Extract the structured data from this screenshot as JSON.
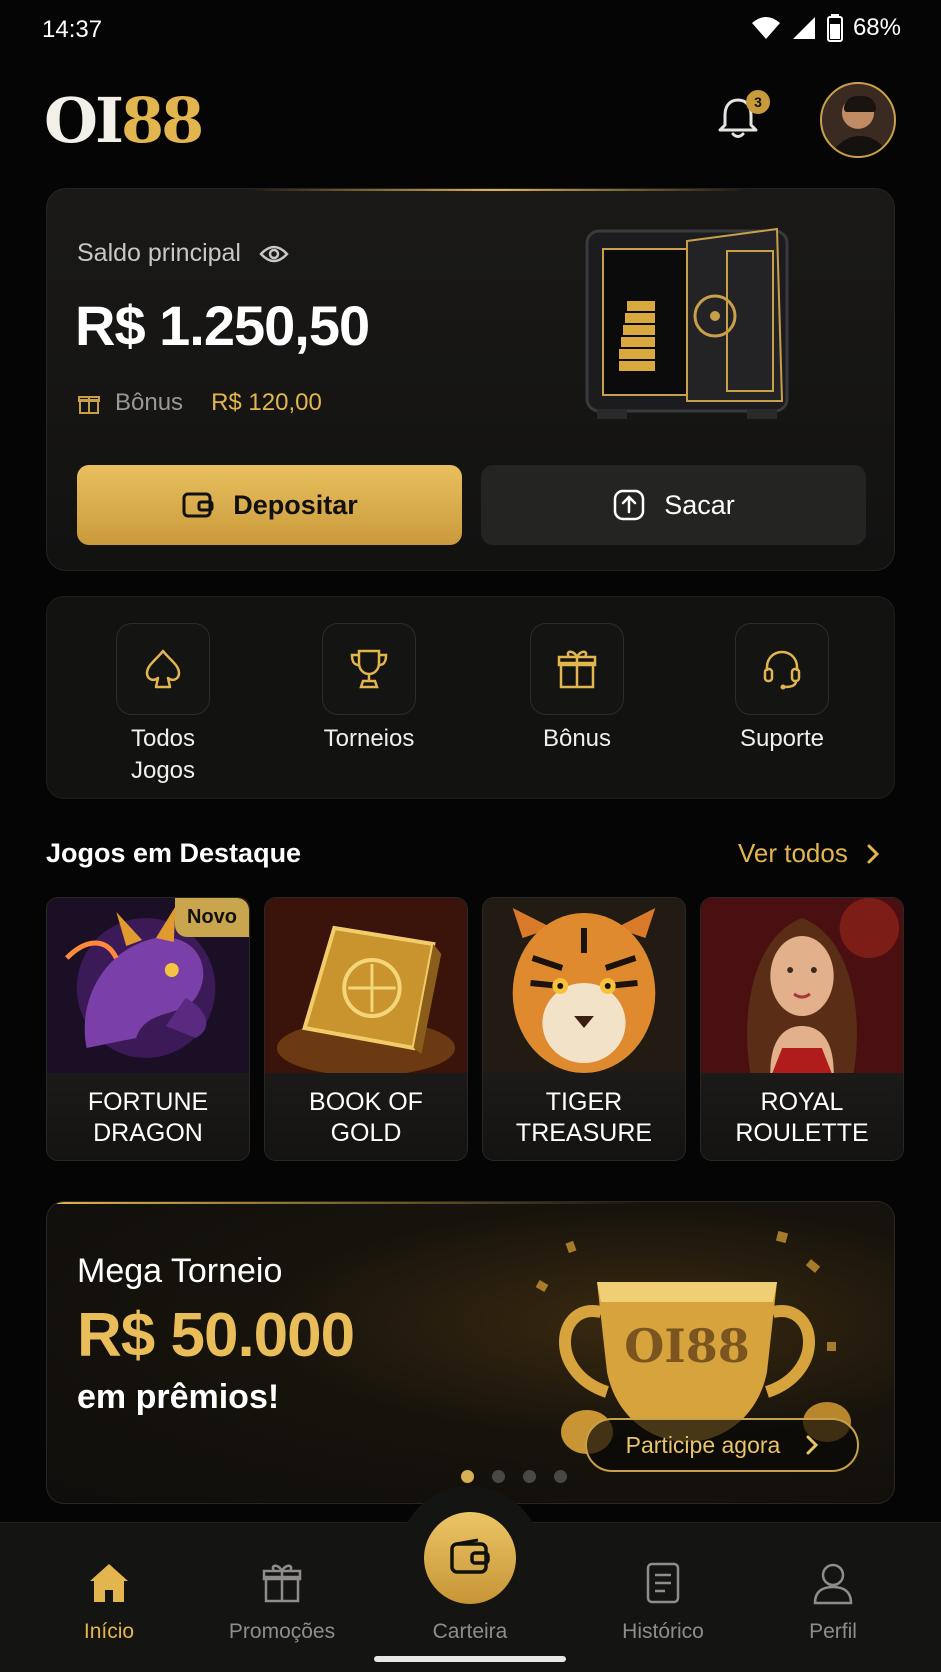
{
  "status_bar": {
    "time": "14:37",
    "battery": "68%"
  },
  "header": {
    "logo_white": "OI",
    "logo_gold": "88",
    "notification_count": "3"
  },
  "balance": {
    "label": "Saldo principal",
    "amount": "R$ 1.250,50",
    "bonus_label": "Bônus",
    "bonus_value": "R$ 120,00",
    "deposit_label": "Depositar",
    "withdraw_label": "Sacar"
  },
  "quick_actions": [
    {
      "label": "Todos\nJogos",
      "icon": "spade-icon"
    },
    {
      "label": "Torneios",
      "icon": "trophy-icon"
    },
    {
      "label": "Bônus",
      "icon": "gift-icon"
    },
    {
      "label": "Suporte",
      "icon": "headset-icon"
    }
  ],
  "featured": {
    "title": "Jogos em Destaque",
    "see_all": "Ver todos",
    "badge_new": "Novo",
    "games": [
      {
        "line1": "FORTUNE",
        "line2": "DRAGON"
      },
      {
        "line1": "BOOK OF",
        "line2": "GOLD"
      },
      {
        "line1": "TIGER",
        "line2": "TREASURE"
      },
      {
        "line1": "ROYAL",
        "line2": "ROULETTE"
      }
    ]
  },
  "promo": {
    "subtitle": "Mega Torneio",
    "amount": "R$ 50.000",
    "tail": "em prêmios!",
    "cta": "Participe agora",
    "cup_text": "OI88",
    "slides": 4,
    "active_slide": 1
  },
  "nav": {
    "items": [
      "Início",
      "Promoções",
      "Carteira",
      "Histórico",
      "Perfil"
    ],
    "active": "Início"
  },
  "colors": {
    "gold": "#e2b54f",
    "background": "#050505",
    "card": "#141413"
  }
}
